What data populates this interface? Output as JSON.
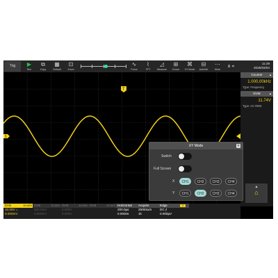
{
  "toolbar": {
    "trig_label": "Trig",
    "buttons": [
      {
        "label": "Run",
        "icon": "play-icon"
      },
      {
        "label": "Copy",
        "icon": "copy-icon"
      },
      {
        "label": "Default",
        "icon": "default-icon"
      },
      {
        "label": "Zoom",
        "icon": "zoom-icon"
      },
      {
        "label": "Force",
        "icon": "force-icon"
      },
      {
        "label": "FFT",
        "icon": "fft-icon"
      },
      {
        "label": "Measure",
        "icon": "measure-icon"
      },
      {
        "label": "Cursor",
        "icon": "cursor-icon"
      },
      {
        "label": "XY Mode",
        "icon": "xy-mode-icon"
      },
      {
        "label": "AutoSet",
        "icon": "autoset-icon"
      },
      {
        "label": "More",
        "icon": "more-icon"
      }
    ],
    "time": "11:29",
    "date": "2025/03/04",
    "icons": [
      "wifi-icon",
      "usb-icon",
      "network-icon"
    ]
  },
  "plot": {
    "trigger_marker": "T",
    "ch1_marker": "1",
    "colors": {
      "ch1": "#f1d21a",
      "grid": "#3c3c3c",
      "background": "#000000"
    }
  },
  "right_panel": {
    "counter_title": "Counter",
    "counter_value": "1.000,00kHz",
    "counter_type": "Type: Frequency",
    "dvm_title": "DVM",
    "dvm_value": "11.74V",
    "dvm_type": "Type: AC RMS",
    "up_icon": "chevron-up-icon",
    "home_icon": "home-icon"
  },
  "bottom": {
    "ch1": {
      "name": "CH1",
      "level": "10.00X",
      "scale": "10.00V",
      "offset": "0.000mV",
      "coupling": "="
    },
    "ch2": {
      "name": "CH2",
      "level": "10.00X",
      "scale": "500.0mV",
      "offset": "0.000mV"
    },
    "ch3": {
      "name": "CH3",
      "level": "10.00X",
      "scale": "5.000V",
      "offset": "0.000V"
    },
    "ch4": {
      "name": "CH4",
      "level": "10.00X",
      "scale": "",
      "offset": ""
    },
    "horizontal": {
      "title": "Horizontal",
      "timebase": "200.0µs",
      "offset": "0.000ns"
    },
    "acquire": {
      "title": "Acquire",
      "rate": "250kSa/s",
      "depth": "1k"
    },
    "edge": {
      "title": "Edge",
      "source": "1",
      "coupling": "DC ⨍",
      "level": "0.000µV"
    }
  },
  "xy_dialog": {
    "title": "XY Mode",
    "switch_label": "Switch",
    "fullscreen_label": "Full Screen",
    "x_label": "X",
    "y_label": "Y",
    "x_channels": [
      "CH1",
      "CH2",
      "CH3",
      "CH4"
    ],
    "y_channels": [
      "CH1",
      "CH2",
      "CH3",
      "CH4"
    ],
    "x_selected": "CH1",
    "y_selected": "CH2"
  }
}
